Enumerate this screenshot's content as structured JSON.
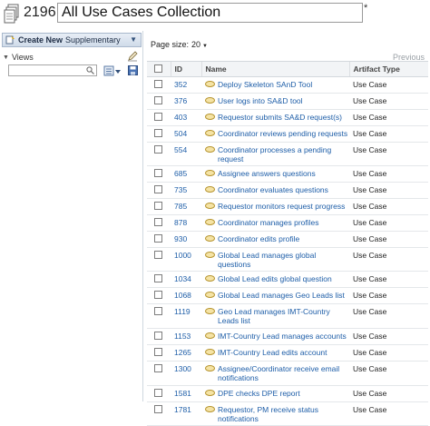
{
  "header": {
    "id_label": "2196:",
    "title_value": "All Use Cases Collection",
    "required_star": "*"
  },
  "sidebar": {
    "create_bold": "Create New",
    "create_rest": "Supplementary",
    "views_label": "Views",
    "search_placeholder": ""
  },
  "main": {
    "page_size_label": "Page size:",
    "page_size_value": "20",
    "previous_label": "Previous",
    "columns": {
      "id": "ID",
      "name": "Name",
      "type": "Artifact Type"
    },
    "rows": [
      {
        "id": "352",
        "name": "Deploy Skeleton SAnD Tool",
        "type": "Use Case"
      },
      {
        "id": "376",
        "name": "User logs into SA&D tool",
        "type": "Use Case"
      },
      {
        "id": "403",
        "name": "Requestor submits SA&D request(s)",
        "type": "Use Case"
      },
      {
        "id": "504",
        "name": "Coordinator reviews pending requests",
        "type": "Use Case"
      },
      {
        "id": "554",
        "name": "Coordinator processes a pending request",
        "type": "Use Case"
      },
      {
        "id": "685",
        "name": "Assignee answers questions",
        "type": "Use Case"
      },
      {
        "id": "735",
        "name": "Coordinator evaluates questions",
        "type": "Use Case"
      },
      {
        "id": "785",
        "name": "Requestor monitors request progress",
        "type": "Use Case"
      },
      {
        "id": "878",
        "name": "Coordinator manages profiles",
        "type": "Use Case"
      },
      {
        "id": "930",
        "name": "Coordinator edits profile",
        "type": "Use Case"
      },
      {
        "id": "1000",
        "name": "Global Lead manages global questions",
        "type": "Use Case"
      },
      {
        "id": "1034",
        "name": "Global Lead edits global question",
        "type": "Use Case"
      },
      {
        "id": "1068",
        "name": "Global Lead manages Geo Leads list",
        "type": "Use Case"
      },
      {
        "id": "1119",
        "name": "Geo Lead manages IMT-Country Leads list",
        "type": "Use Case"
      },
      {
        "id": "1153",
        "name": "IMT-Country Lead manages accounts",
        "type": "Use Case"
      },
      {
        "id": "1265",
        "name": "IMT-Country Lead edits account",
        "type": "Use Case"
      },
      {
        "id": "1300",
        "name": "Assignee/Coordinator receive email notifications",
        "type": "Use Case"
      },
      {
        "id": "1581",
        "name": "DPE checks DPE report",
        "type": "Use Case"
      },
      {
        "id": "1781",
        "name": "Requestor, PM receive status notifications",
        "type": "Use Case"
      }
    ]
  },
  "icons": {
    "collection": "collection-icon",
    "use_case": "use-case-icon",
    "search": "search-icon",
    "edit": "pencil-icon",
    "save": "save-icon"
  },
  "colors": {
    "link": "#1e5ea8",
    "header_bg": "#f2f4f6",
    "create_button": "#cfdbe9"
  }
}
